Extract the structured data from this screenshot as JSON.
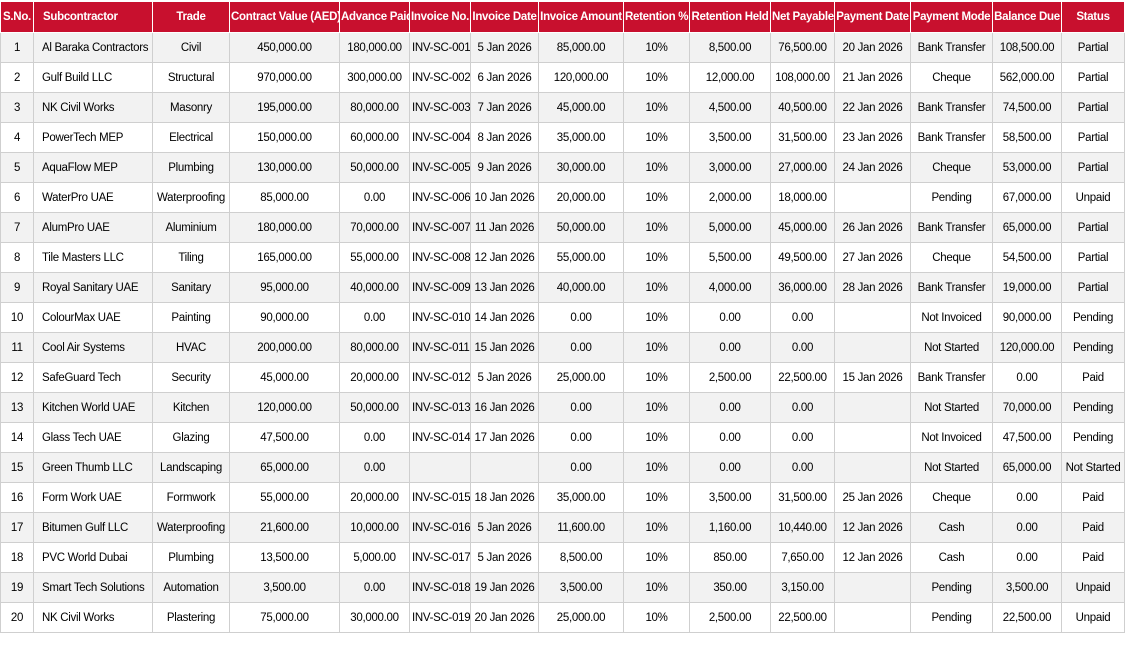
{
  "columns": [
    "S.No.",
    "Subcontractor",
    "Trade",
    "Contract Value (AED)",
    "Advance Paid",
    "Invoice No.",
    "Invoice Date",
    "Invoice Amount",
    "Retention %",
    "Retention Held",
    "Net Payable",
    "Payment Date",
    "Payment Mode",
    "Balance Due",
    "Status"
  ],
  "rows": [
    [
      "1",
      "Al Baraka Contractors",
      "Civil",
      "450,000.00",
      "180,000.00",
      "INV-SC-001",
      "5 Jan 2026",
      "85,000.00",
      "10%",
      "8,500.00",
      "76,500.00",
      "20 Jan 2026",
      "Bank Transfer",
      "108,500.00",
      "Partial"
    ],
    [
      "2",
      "Gulf Build LLC",
      "Structural",
      "970,000.00",
      "300,000.00",
      "INV-SC-002",
      "6 Jan 2026",
      "120,000.00",
      "10%",
      "12,000.00",
      "108,000.00",
      "21 Jan 2026",
      "Cheque",
      "562,000.00",
      "Partial"
    ],
    [
      "3",
      "NK Civil Works",
      "Masonry",
      "195,000.00",
      "80,000.00",
      "INV-SC-003",
      "7 Jan 2026",
      "45,000.00",
      "10%",
      "4,500.00",
      "40,500.00",
      "22 Jan 2026",
      "Bank Transfer",
      "74,500.00",
      "Partial"
    ],
    [
      "4",
      "PowerTech MEP",
      "Electrical",
      "150,000.00",
      "60,000.00",
      "INV-SC-004",
      "8 Jan 2026",
      "35,000.00",
      "10%",
      "3,500.00",
      "31,500.00",
      "23 Jan 2026",
      "Bank Transfer",
      "58,500.00",
      "Partial"
    ],
    [
      "5",
      "AquaFlow MEP",
      "Plumbing",
      "130,000.00",
      "50,000.00",
      "INV-SC-005",
      "9 Jan 2026",
      "30,000.00",
      "10%",
      "3,000.00",
      "27,000.00",
      "24 Jan 2026",
      "Cheque",
      "53,000.00",
      "Partial"
    ],
    [
      "6",
      "WaterPro UAE",
      "Waterproofing",
      "85,000.00",
      "0.00",
      "INV-SC-006",
      "10 Jan 2026",
      "20,000.00",
      "10%",
      "2,000.00",
      "18,000.00",
      "",
      "Pending",
      "67,000.00",
      "Unpaid"
    ],
    [
      "7",
      "AlumPro UAE",
      "Aluminium",
      "180,000.00",
      "70,000.00",
      "INV-SC-007",
      "11 Jan 2026",
      "50,000.00",
      "10%",
      "5,000.00",
      "45,000.00",
      "26 Jan 2026",
      "Bank Transfer",
      "65,000.00",
      "Partial"
    ],
    [
      "8",
      "Tile Masters LLC",
      "Tiling",
      "165,000.00",
      "55,000.00",
      "INV-SC-008",
      "12 Jan 2026",
      "55,000.00",
      "10%",
      "5,500.00",
      "49,500.00",
      "27 Jan 2026",
      "Cheque",
      "54,500.00",
      "Partial"
    ],
    [
      "9",
      "Royal Sanitary UAE",
      "Sanitary",
      "95,000.00",
      "40,000.00",
      "INV-SC-009",
      "13 Jan 2026",
      "40,000.00",
      "10%",
      "4,000.00",
      "36,000.00",
      "28 Jan 2026",
      "Bank Transfer",
      "19,000.00",
      "Partial"
    ],
    [
      "10",
      "ColourMax UAE",
      "Painting",
      "90,000.00",
      "0.00",
      "INV-SC-010",
      "14 Jan 2026",
      "0.00",
      "10%",
      "0.00",
      "0.00",
      "",
      "Not Invoiced",
      "90,000.00",
      "Pending"
    ],
    [
      "11",
      "Cool Air Systems",
      "HVAC",
      "200,000.00",
      "80,000.00",
      "INV-SC-011",
      "15 Jan 2026",
      "0.00",
      "10%",
      "0.00",
      "0.00",
      "",
      "Not Started",
      "120,000.00",
      "Pending"
    ],
    [
      "12",
      "SafeGuard Tech",
      "Security",
      "45,000.00",
      "20,000.00",
      "INV-SC-012",
      "5 Jan 2026",
      "25,000.00",
      "10%",
      "2,500.00",
      "22,500.00",
      "15 Jan 2026",
      "Bank Transfer",
      "0.00",
      "Paid"
    ],
    [
      "13",
      "Kitchen World UAE",
      "Kitchen",
      "120,000.00",
      "50,000.00",
      "INV-SC-013",
      "16 Jan 2026",
      "0.00",
      "10%",
      "0.00",
      "0.00",
      "",
      "Not Started",
      "70,000.00",
      "Pending"
    ],
    [
      "14",
      "Glass Tech UAE",
      "Glazing",
      "47,500.00",
      "0.00",
      "INV-SC-014",
      "17 Jan 2026",
      "0.00",
      "10%",
      "0.00",
      "0.00",
      "",
      "Not Invoiced",
      "47,500.00",
      "Pending"
    ],
    [
      "15",
      "Green Thumb LLC",
      "Landscaping",
      "65,000.00",
      "0.00",
      "",
      "",
      "0.00",
      "10%",
      "0.00",
      "0.00",
      "",
      "Not Started",
      "65,000.00",
      "Not Started"
    ],
    [
      "16",
      "Form Work UAE",
      "Formwork",
      "55,000.00",
      "20,000.00",
      "INV-SC-015",
      "18 Jan 2026",
      "35,000.00",
      "10%",
      "3,500.00",
      "31,500.00",
      "25 Jan 2026",
      "Cheque",
      "0.00",
      "Paid"
    ],
    [
      "17",
      "Bitumen Gulf LLC",
      "Waterproofing",
      "21,600.00",
      "10,000.00",
      "INV-SC-016",
      "5 Jan 2026",
      "11,600.00",
      "10%",
      "1,160.00",
      "10,440.00",
      "12 Jan 2026",
      "Cash",
      "0.00",
      "Paid"
    ],
    [
      "18",
      "PVC World Dubai",
      "Plumbing",
      "13,500.00",
      "5,000.00",
      "INV-SC-017",
      "5 Jan 2026",
      "8,500.00",
      "10%",
      "850.00",
      "7,650.00",
      "12 Jan 2026",
      "Cash",
      "0.00",
      "Paid"
    ],
    [
      "19",
      "Smart Tech Solutions",
      "Automation",
      "3,500.00",
      "0.00",
      "INV-SC-018",
      "19 Jan 2026",
      "3,500.00",
      "10%",
      "350.00",
      "3,150.00",
      "",
      "Pending",
      "3,500.00",
      "Unpaid"
    ],
    [
      "20",
      "NK Civil Works",
      "Plastering",
      "75,000.00",
      "30,000.00",
      "INV-SC-019",
      "20 Jan 2026",
      "25,000.00",
      "10%",
      "2,500.00",
      "22,500.00",
      "",
      "Pending",
      "22,500.00",
      "Unpaid"
    ]
  ],
  "colors": {
    "header_bg": "#c8102e",
    "header_text": "#ffffff",
    "row_alt_bg": "#f2f2f2",
    "border": "#cfcfcf"
  }
}
